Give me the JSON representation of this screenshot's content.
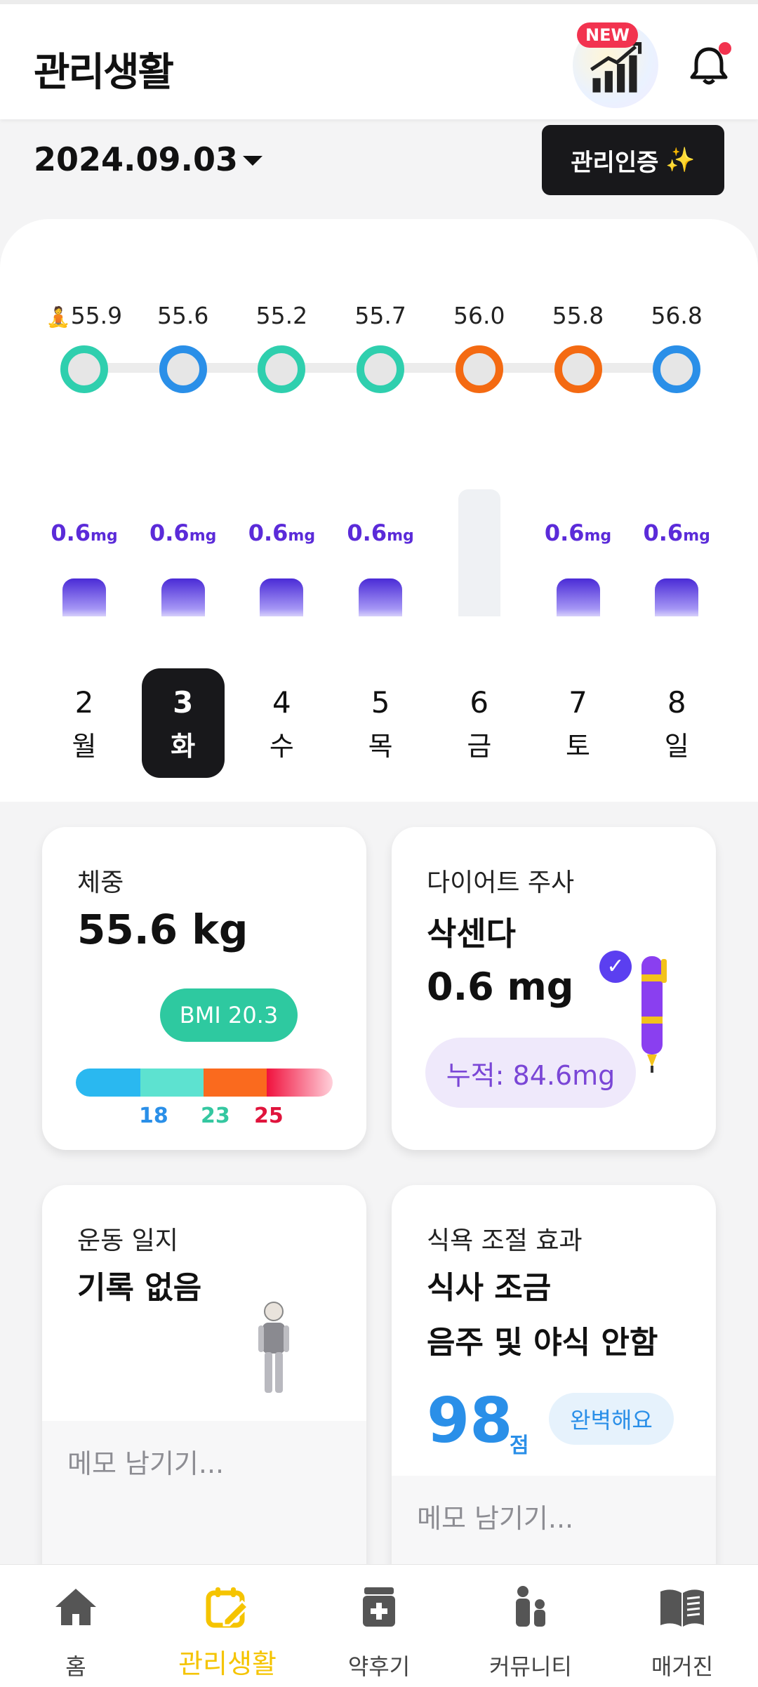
{
  "header": {
    "title": "관리생활",
    "new_badge": "NEW",
    "stats_icon": "bar-chart-up-icon",
    "bell_icon": "bell-icon"
  },
  "date_bar": {
    "date": "2024.09.03",
    "cert_button": "관리인증",
    "cert_emoji": "✨"
  },
  "week": {
    "weight_emoji": "🧘",
    "days": [
      {
        "weight": "55.9",
        "dose": "0.6",
        "dose_unit": "mg",
        "dose_level": 1,
        "num": "2",
        "name": "월",
        "status_color": "#2fcfae",
        "selected": false
      },
      {
        "weight": "55.6",
        "dose": "0.6",
        "dose_unit": "mg",
        "dose_level": 1,
        "num": "3",
        "name": "화",
        "status_color": "#2a8fe8",
        "selected": true
      },
      {
        "weight": "55.2",
        "dose": "0.6",
        "dose_unit": "mg",
        "dose_level": 1,
        "num": "4",
        "name": "수",
        "status_color": "#2fcfae",
        "selected": false
      },
      {
        "weight": "55.7",
        "dose": "0.6",
        "dose_unit": "mg",
        "dose_level": 1,
        "num": "5",
        "name": "목",
        "status_color": "#2fcfae",
        "selected": false
      },
      {
        "weight": "56.0",
        "dose": "",
        "dose_unit": "",
        "dose_level": 0,
        "num": "6",
        "name": "금",
        "status_color": "#f46a12",
        "selected": false
      },
      {
        "weight": "55.8",
        "dose": "0.6",
        "dose_unit": "mg",
        "dose_level": 1,
        "num": "7",
        "name": "토",
        "status_color": "#f46a12",
        "selected": false
      },
      {
        "weight": "56.8",
        "dose": "0.6",
        "dose_unit": "mg",
        "dose_level": 1,
        "num": "8",
        "name": "일",
        "status_color": "#2a8fe8",
        "selected": false
      }
    ]
  },
  "weight_card": {
    "label": "체중",
    "value": "55.6 kg",
    "bmi": "BMI 20.3",
    "scale_colors": [
      "#2ab8f0",
      "#5de2d0",
      "#fa6a1e",
      "#f0123e"
    ],
    "ticks": [
      {
        "label": "18",
        "color": "#2a8fe8"
      },
      {
        "label": "23",
        "color": "#34c7a0"
      },
      {
        "label": "25",
        "color": "#e0143c"
      }
    ]
  },
  "injection_card": {
    "label": "다이어트 주사",
    "drug": "삭센다",
    "dose": "0.6 mg",
    "cumulative": "누적: 84.6mg",
    "check_icon": "check-circle-icon",
    "pen_icon": "injection-pen-icon"
  },
  "exercise_card": {
    "label": "운동 일지",
    "status": "기록 없음",
    "figure_icon": "person-figure-icon",
    "memo_placeholder": "메모 남기기..."
  },
  "appetite_card": {
    "label": "식욕 조절 효과",
    "line1": "식사 조금",
    "line2": "음주 및 야식 안함",
    "score": "98",
    "score_unit": "점",
    "score_badge": "완벽해요",
    "memo_placeholder": "메모 남기기..."
  },
  "nav": {
    "items": [
      {
        "label": "홈",
        "icon": "home-icon",
        "active": false
      },
      {
        "label": "관리생활",
        "icon": "calendar-edit-icon",
        "active": true
      },
      {
        "label": "약후기",
        "icon": "medicine-icon",
        "active": false
      },
      {
        "label": "커뮤니티",
        "icon": "community-icon",
        "active": false
      },
      {
        "label": "매거진",
        "icon": "magazine-icon",
        "active": false
      }
    ]
  }
}
